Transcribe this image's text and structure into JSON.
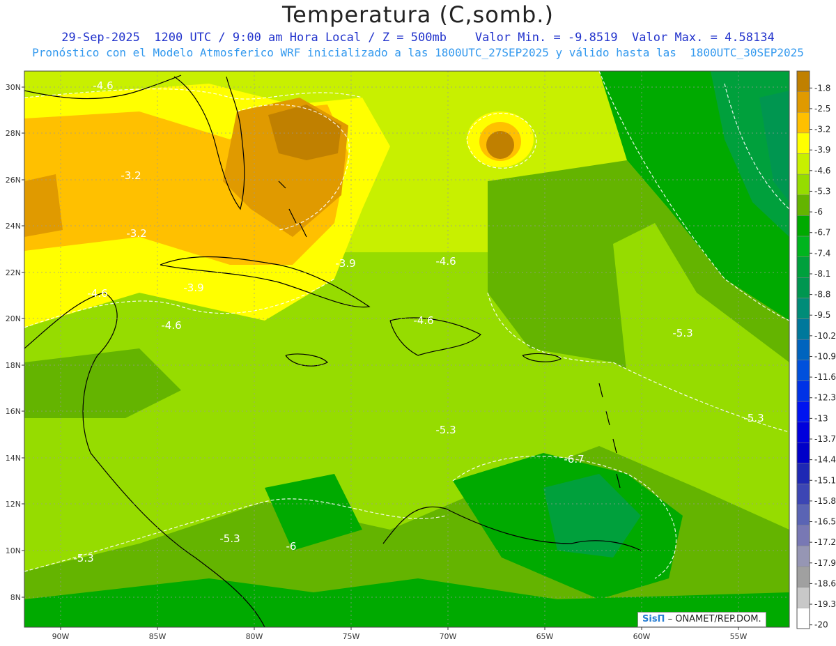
{
  "header": {
    "title": "Temperatura (C,somb.)",
    "line1": "29-Sep-2025  1200 UTC / 9:00 am Hora Local / Z = 500mb    Valor Min. = -9.8519  Valor Max. = 4.58134",
    "line2": "Pronóstico con el Modelo Atmosferico WRF inicializado a las 1800UTC_27SEP2025 y válido hasta las  1800UTC_30SEP2025"
  },
  "axes": {
    "lat_labels": [
      "30N",
      "28N",
      "26N",
      "24N",
      "22N",
      "20N",
      "18N",
      "16N",
      "14N",
      "12N",
      "10N",
      "8N"
    ],
    "lon_labels": [
      "90W",
      "85W",
      "80W",
      "75W",
      "70W",
      "65W",
      "60W",
      "55W"
    ]
  },
  "legend": {
    "levels": [
      "-1.8",
      "-2.5",
      "-3.2",
      "-3.9",
      "-4.6",
      "-5.3",
      "-6",
      "-6.7",
      "-7.4",
      "-8.1",
      "-8.8",
      "-9.5",
      "-10.2",
      "-10.9",
      "-11.6",
      "-12.3",
      "-13",
      "-13.7",
      "-14.4",
      "-15.1",
      "-15.8",
      "-16.5",
      "-17.2",
      "-17.9",
      "-18.6",
      "-19.3",
      "-20"
    ],
    "colors": [
      "#c08000",
      "#e09a00",
      "#ffc000",
      "#ffff00",
      "#c8f000",
      "#96dc00",
      "#64b400",
      "#00aa00",
      "#00b41e",
      "#00a03c",
      "#009650",
      "#008c78",
      "#00789b",
      "#0064be",
      "#0050dc",
      "#0032e6",
      "#0014f0",
      "#0000dc",
      "#0000c8",
      "#1e28b4",
      "#3c46b4",
      "#5a64b4",
      "#7878b4",
      "#9696b4",
      "#a0a0a0",
      "#c8c8c8",
      "#ffffff"
    ]
  },
  "contour_labels": [
    {
      "text": "-4.6"
    },
    {
      "text": "-3.2"
    },
    {
      "text": "-3.2"
    },
    {
      "text": "-3.9"
    },
    {
      "text": "-3.9"
    },
    {
      "text": "-4.6"
    },
    {
      "text": "-4.6"
    },
    {
      "text": "-4.6"
    },
    {
      "text": "-4.6"
    },
    {
      "text": "-5.3"
    },
    {
      "text": "-5.3"
    },
    {
      "text": "-5.3"
    },
    {
      "text": "-6.7"
    },
    {
      "text": "-5.3"
    },
    {
      "text": "-5.3"
    },
    {
      "text": "-6"
    }
  ],
  "credit": {
    "brand": "SisΠ",
    "text": "– ONAMET/REP.DOM."
  }
}
